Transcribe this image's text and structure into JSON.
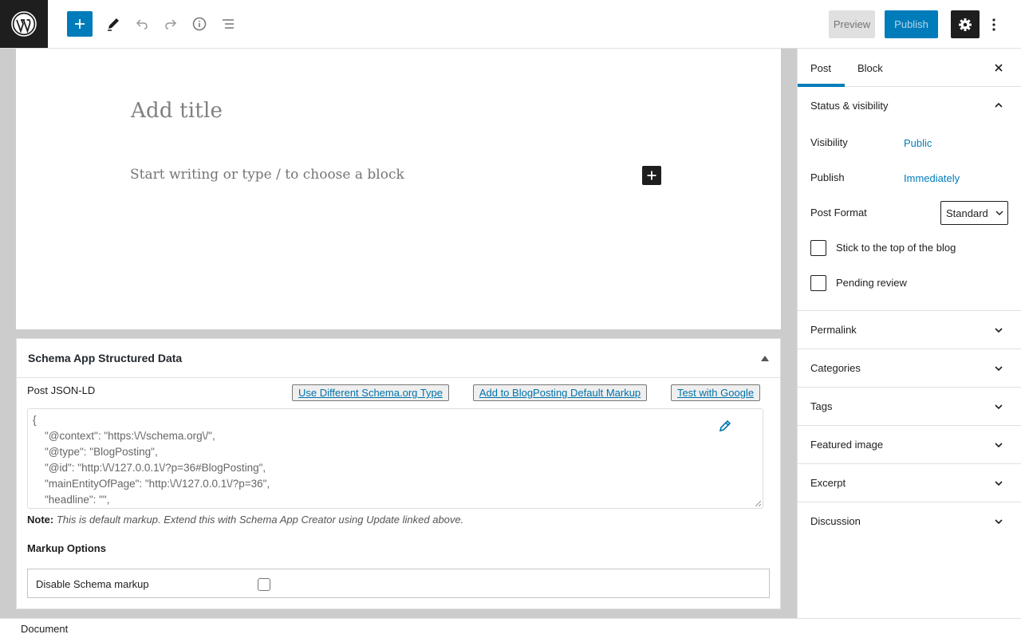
{
  "toolbar": {
    "preview_label": "Preview",
    "publish_label": "Publish"
  },
  "editor": {
    "title_placeholder": "Add title",
    "paragraph_placeholder": "Start writing or type / to choose a block"
  },
  "metabox": {
    "title": "Schema App Structured Data",
    "json_label": "Post JSON-LD",
    "buttons": {
      "different_type": "Use Different Schema.org Type",
      "add_default": "Add to BlogPosting Default Markup",
      "test_google": "Test with Google"
    },
    "json_lines": [
      "{",
      "    \"@context\": \"https:\\/\\/schema.org\\/\",",
      "    \"@type\": \"BlogPosting\",",
      "    \"@id\": \"http:\\/\\/127.0.0.1\\/?p=36#BlogPosting\",",
      "    \"mainEntityOfPage\": \"http:\\/\\/127.0.0.1\\/?p=36\",",
      "    \"headline\": \"\","
    ],
    "note_label": "Note:",
    "note_text": "This is default markup. Extend this with Schema App Creator using Update linked above.",
    "markup_options_title": "Markup Options",
    "disable_label": "Disable Schema markup"
  },
  "footer": {
    "breadcrumb": "Document"
  },
  "sidebar": {
    "tabs": [
      {
        "label": "Post",
        "active": true
      },
      {
        "label": "Block",
        "active": false
      }
    ],
    "status_panel": {
      "title": "Status & visibility",
      "visibility_label": "Visibility",
      "visibility_value": "Public",
      "publish_label": "Publish",
      "publish_value": "Immediately",
      "post_format_label": "Post Format",
      "post_format_value": "Standard",
      "stick_label": "Stick to the top of the blog",
      "pending_label": "Pending review"
    },
    "panels": [
      "Permalink",
      "Categories",
      "Tags",
      "Featured image",
      "Excerpt",
      "Discussion"
    ]
  },
  "colors": {
    "accent": "#007cba",
    "dark": "#1e1e1e",
    "editor_bg": "#cccccc"
  }
}
